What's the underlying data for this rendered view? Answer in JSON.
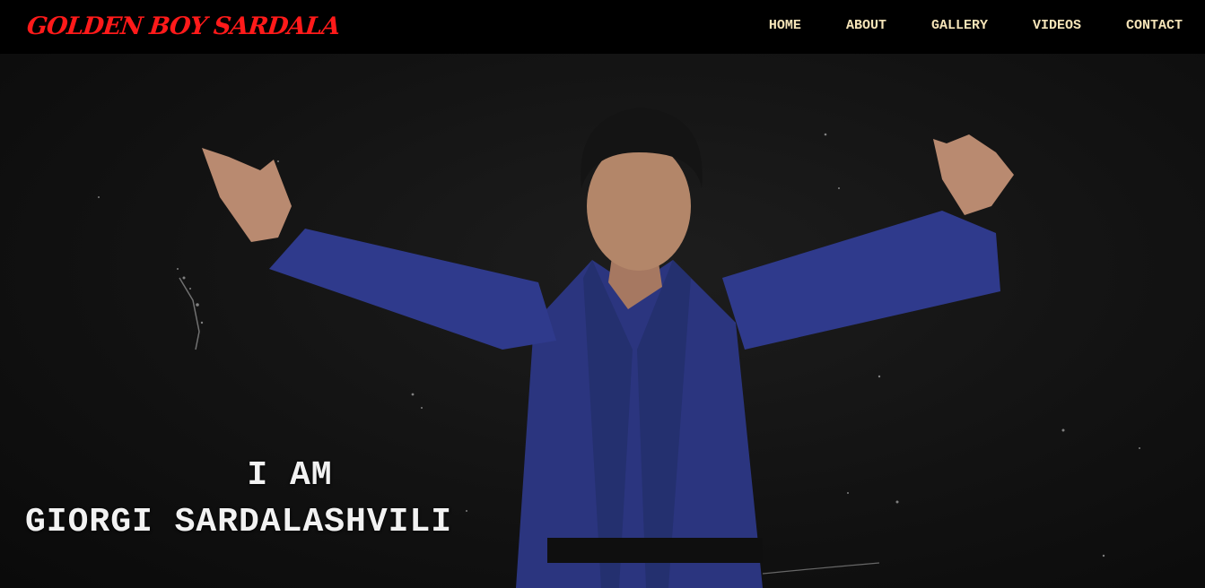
{
  "header": {
    "logo": "GOLDEN BOY SARDALA",
    "nav": [
      {
        "label": "HOME"
      },
      {
        "label": "ABOUT"
      },
      {
        "label": "GALLERY"
      },
      {
        "label": "VIDEOS"
      },
      {
        "label": "CONTACT"
      }
    ]
  },
  "hero": {
    "line1": "I AM",
    "line2": "GIORGI SARDALASHVILI"
  },
  "colors": {
    "logo": "#ff1a1a",
    "nav_text": "#f5e4b8",
    "gi_blue": "#2f3a8c"
  }
}
